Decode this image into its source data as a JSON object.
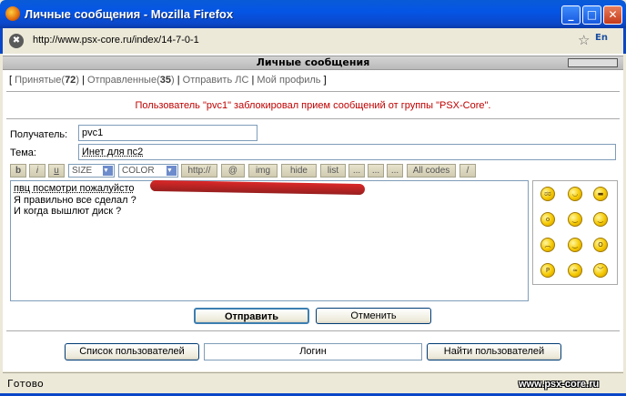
{
  "window": {
    "title": "Личные сообщения - Mozilla Firefox"
  },
  "browser": {
    "url": "http://www.psx-core.ru/index/14-7-0-1",
    "lang": "En",
    "status": "Готово",
    "watermark": "www.psx-core.ru"
  },
  "page": {
    "header": "Личные сообщения",
    "nav": {
      "received_label": "Принятые",
      "received_count": "72",
      "sent_label": "Отправленные",
      "sent_count": "35",
      "send_label": "Отправить ЛС",
      "profile_label": "Мой профиль"
    },
    "notice": "Пользователь \"pvc1\" заблокировал прием сообщений от группы \"PSX-Core\".",
    "form": {
      "recipient_label": "Получатель:",
      "recipient_value": "pvc1",
      "subject_label": "Тема:",
      "subject_value": "Инет  для пс2"
    },
    "toolbar": {
      "bold": "b",
      "italic": "i",
      "underline": "u",
      "size": "SIZE",
      "color": "COLOR",
      "http": "http://",
      "email": "@",
      "img": "img",
      "hide": "hide",
      "list": "list",
      "dots1": "...",
      "dots2": "...",
      "dots3": "...",
      "all_codes": "All codes",
      "slash": "/"
    },
    "message": {
      "line1": "пвц посмотри пожалуйсто",
      "line2": "Я правильно все сделал ?",
      "line3": "И когда вышлют диск ?"
    },
    "buttons": {
      "send": "Отправить",
      "cancel": "Отменить",
      "user_list": "Список пользователей",
      "login_value": "Логин",
      "find_users": "Найти пользователей"
    }
  }
}
